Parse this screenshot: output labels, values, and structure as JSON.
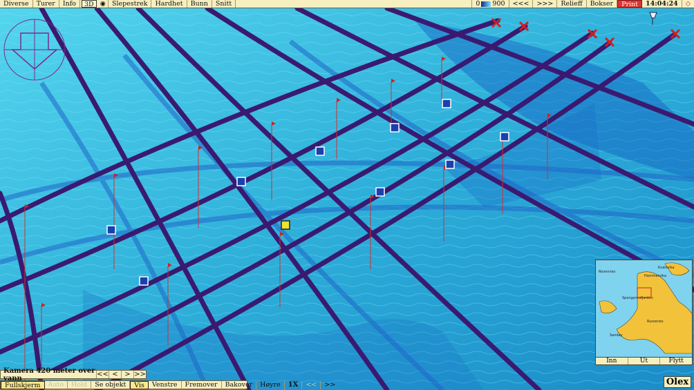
{
  "topbar": {
    "left_menu": [
      "Diverse",
      "Turer",
      "Info",
      "3D"
    ],
    "tools": [
      "Slepestrek",
      "Hardhet",
      "Bunn",
      "Snitt"
    ],
    "depth_min": "0",
    "depth_max": "900",
    "nav_back": "<<<",
    "nav_fwd": ">>>",
    "right_menu": [
      "Relieff",
      "Bokser"
    ],
    "print": "Print",
    "clock": "14:04:24"
  },
  "camera": {
    "label": "Kamera 420 meter over vann",
    "buttons": [
      "<<",
      "<",
      ">",
      ">>"
    ]
  },
  "bottombar": {
    "items": [
      "Fullskjerm",
      "Auto",
      "Hold",
      "Se objekt",
      "Vis",
      "Venstre",
      "Fremover",
      "Bakover",
      "Høyre"
    ],
    "speed": "1X",
    "nav_back": "<<",
    "nav_fwd": ">>"
  },
  "minimap": {
    "place_labels": [
      "Rovennes",
      "Spongsnesfjorden",
      "Hammervika",
      "Kvalsvika",
      "Russenes",
      "Sandøy"
    ],
    "nav": [
      "Inn",
      "Ut",
      "Flytt"
    ]
  },
  "logo": "Olex",
  "colors": {
    "sea": "#2ab4d8",
    "track": "#3a1a70",
    "bar_bg": "#f7efc0",
    "alert": "#e03030",
    "land": "#f2c23a"
  }
}
